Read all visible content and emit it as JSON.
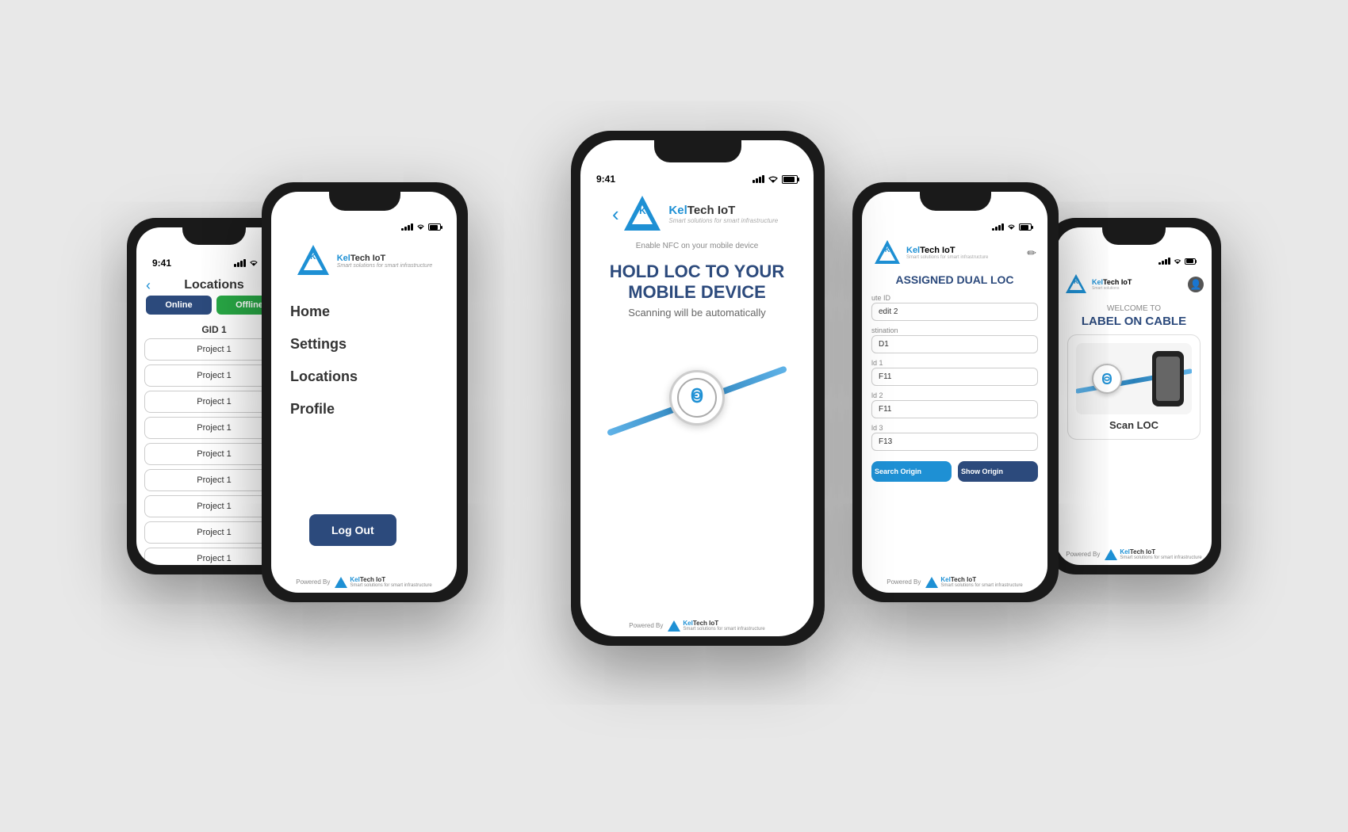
{
  "phones": {
    "phone1": {
      "status_time": "9:41",
      "title": "Locations",
      "tab_online": "Online",
      "tab_offline": "Offline",
      "gid": "GID 1",
      "projects": [
        "Project 1",
        "Project 1",
        "Project 1",
        "Project 1",
        "Project 1",
        "Project 1",
        "Project 1",
        "Project 1",
        "Project 1"
      ]
    },
    "phone2": {
      "logo_brand": "KelTech IoT",
      "logo_tagline": "Smart solutions for smart infrastructure",
      "menu_items": [
        "Home",
        "Settings",
        "Locations",
        "Profile"
      ],
      "logout_label": "Log Out",
      "powered_by": "Powered By"
    },
    "phone3": {
      "status_time": "9:41",
      "enable_nfc": "Enable NFC on your mobile device",
      "main_title": "HOLD LOC TO YOUR MOBILE DEVICE",
      "subtitle": "Scanning will be automatically",
      "powered_by": "Powered By"
    },
    "phone4": {
      "title": "ASSIGNED DUAL LOC",
      "edit_icon": "✏",
      "fields": [
        {
          "label": "ute ID",
          "value": "edit 2"
        },
        {
          "label": "stination",
          "value": "D1"
        },
        {
          "label": "ld 1",
          "value": "F11"
        },
        {
          "label": "ld 2",
          "value": "F11"
        },
        {
          "label": "ld 3",
          "value": "F13"
        }
      ],
      "btn_search": "Search Origin",
      "btn_show": "Show Origin",
      "powered_by": "Powered By"
    },
    "phone5": {
      "welcome_text": "WELCOME TO",
      "title": "LABEL ON CABLE",
      "scan_loc_label": "Scan LOC",
      "powered_by": "Powered By"
    }
  },
  "brand": {
    "name": "KelTech IoT",
    "tagline": "Smart solutions for smart infrastructure",
    "accent_color": "#1e90d4",
    "dark_color": "#2c4a7c"
  }
}
